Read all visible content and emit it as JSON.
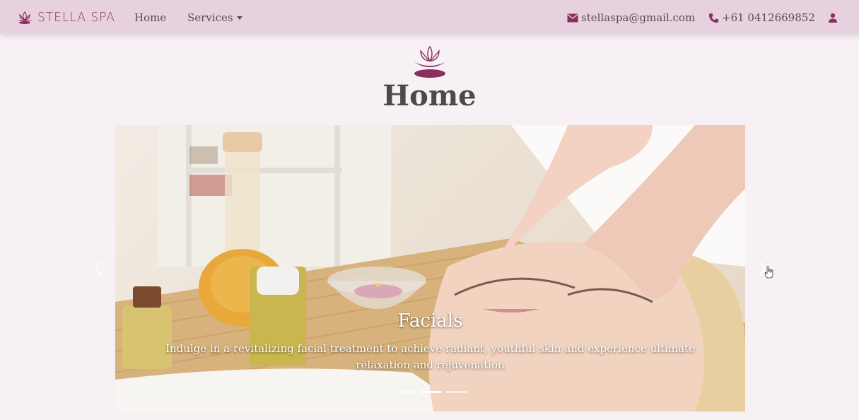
{
  "navbar": {
    "brand": "STELLA SPA",
    "links": [
      {
        "label": "Home"
      },
      {
        "label": "Services"
      }
    ],
    "email": "stellaspa@gmail.com",
    "phone": "+61 0412669852"
  },
  "page": {
    "title": "Home"
  },
  "carousel": {
    "slides_count": 3,
    "active_slide": 2,
    "caption_title": "Facials",
    "caption_text": "Indulge in a revitalizing facial treatment to achieve radiant, youthful skin and experience ultimate relaxation and rejuvenation"
  },
  "colors": {
    "navbar_bg": "#e8d1df",
    "brand": "#8a2f5e",
    "page_bg": "#f7f1f6"
  }
}
